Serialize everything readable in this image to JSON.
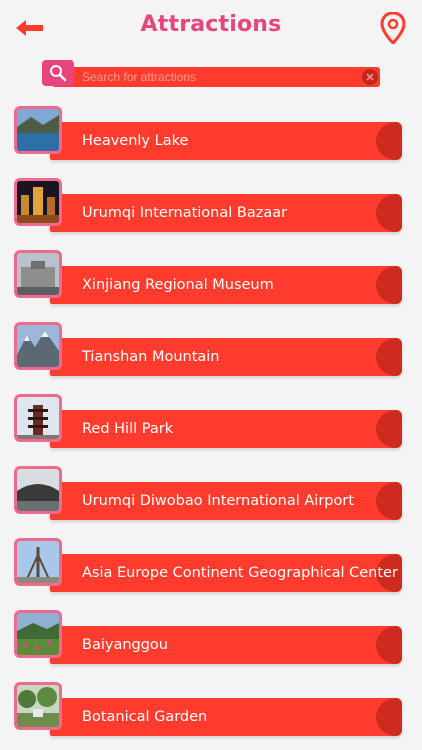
{
  "header": {
    "title": "Attractions",
    "back_icon": "back-arrow-icon",
    "location_icon": "map-pin-icon"
  },
  "search": {
    "placeholder": "Search for attractions",
    "value": ""
  },
  "colors": {
    "accent": "#e8447e",
    "bar": "#ff3b2d",
    "bar_cap": "#cf2a1f",
    "thumb_border": "#f06a8f",
    "background": "#f4f4f4"
  },
  "attractions": [
    {
      "label": "Heavenly Lake",
      "thumb": "lake-photo"
    },
    {
      "label": "Urumqi International Bazaar",
      "thumb": "bazaar-photo"
    },
    {
      "label": "Xinjiang Regional Museum",
      "thumb": "museum-photo"
    },
    {
      "label": "Tianshan Mountain",
      "thumb": "mountain-photo"
    },
    {
      "label": "Red Hill Park",
      "thumb": "pagoda-photo"
    },
    {
      "label": "Urumqi Diwobao International Airport",
      "thumb": "airport-photo"
    },
    {
      "label": "Asia Europe Continent Geographical Center",
      "thumb": "monument-photo"
    },
    {
      "label": "Baiyanggou",
      "thumb": "meadow-photo"
    },
    {
      "label": "Botanical Garden",
      "thumb": "garden-photo"
    }
  ]
}
